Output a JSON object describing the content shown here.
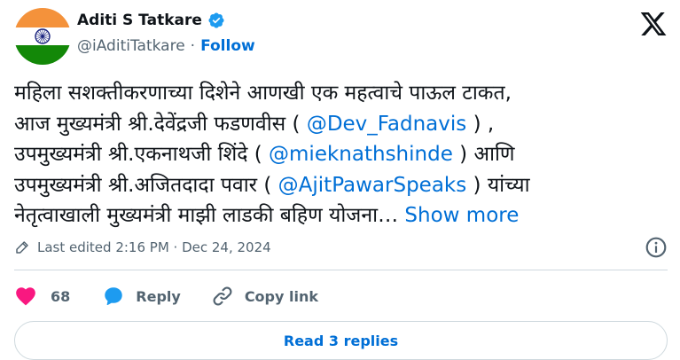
{
  "author": {
    "name": "Aditi S Tatkare",
    "handle": "@iAditiTatkare",
    "separator": "·",
    "follow_label": "Follow",
    "verified_color": "#1d9bf0"
  },
  "tweet": {
    "lines": [
      {
        "text": "महिला सशक्तीकरणाच्या दिशेने आणखी एक महत्वाचे पाऊल टाकत,"
      },
      {
        "pre": "आज मुख्यमंत्री श्री.देवेंद्रजी फडणवीस ( ",
        "mention": "@Dev_Fadnavis",
        "post": " ) ,"
      },
      {
        "pre": "उपमुख्यमंत्री श्री.एकनाथजी शिंदे ( ",
        "mention": "@mieknathshinde",
        "post": " ) आणि"
      },
      {
        "pre": "उपमुख्यमंत्री श्री.अजितदादा पवार ( ",
        "mention": "@AjitPawarSpeaks",
        "post": " ) यांच्या"
      },
      {
        "pre": "नेतृत्वाखाली मुख्यमंत्री माझी लाडकी बहिण योजना… ",
        "show_more": "Show more"
      }
    ]
  },
  "meta": {
    "edited": "Last edited 2:16 PM · Dec 24, 2024"
  },
  "actions": {
    "like_count": "68",
    "reply_label": "Reply",
    "copy_label": "Copy link"
  },
  "read_replies_label": "Read 3 replies",
  "colors": {
    "link": "#006fd6",
    "like": "#f91880",
    "saffron": "#f4923b",
    "green": "#138808",
    "chakra": "#1a237e"
  },
  "icons": [
    "india-flag-avatar",
    "verified-badge-icon",
    "x-logo-icon",
    "pencil-icon",
    "info-icon",
    "heart-icon",
    "reply-bubble-icon",
    "link-icon"
  ]
}
